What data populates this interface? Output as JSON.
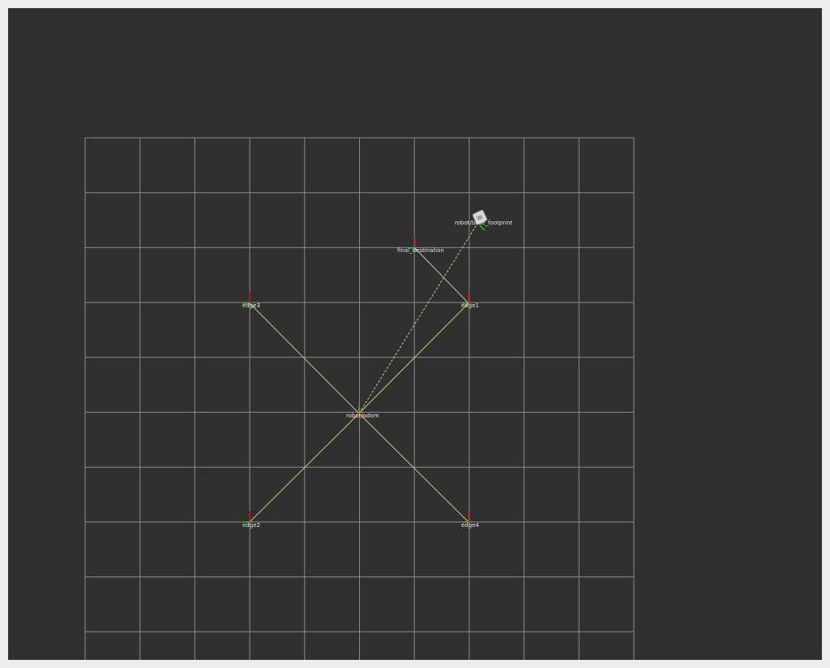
{
  "scene": {
    "background_color": "#303030",
    "grid_color": "#8a8a8a",
    "link_color": "#c9c97a",
    "axis_x_color": "#d01010",
    "axis_y_color": "#19c819",
    "grid": true
  },
  "frames": [
    {
      "id": "robot_link",
      "label": "robot/base_footprint",
      "icon": "robot-marker-icon",
      "shape": "cube"
    },
    {
      "id": "final_destination",
      "label": "final_destination"
    },
    {
      "id": "origin",
      "label": "robot/odom"
    },
    {
      "id": "edge3",
      "label": "edge3"
    },
    {
      "id": "edge1",
      "label": "edge1"
    },
    {
      "id": "edge2",
      "label": "edge2"
    },
    {
      "id": "edge4",
      "label": "edge4"
    }
  ]
}
